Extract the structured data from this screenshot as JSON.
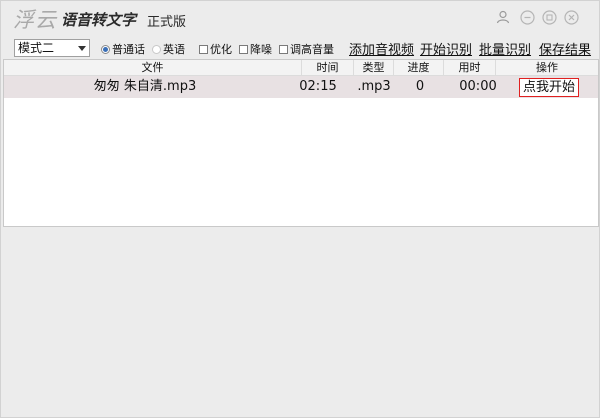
{
  "titlebar": {
    "brand": "浮云",
    "app_name": "语音转文字",
    "edition": "正式版",
    "controls": [
      "user-icon",
      "minimize-icon",
      "maximize-icon",
      "close-icon"
    ]
  },
  "toolbar": {
    "mode_select": {
      "value": "模式二"
    },
    "language_options": [
      {
        "label": "普通话",
        "selected": true
      },
      {
        "label": "英语",
        "selected": false
      }
    ],
    "checkboxes": [
      {
        "label": "优化",
        "checked": false
      },
      {
        "label": "降噪",
        "checked": false
      },
      {
        "label": "调高音量",
        "checked": false
      }
    ],
    "actions": {
      "add_media": "添加音视频",
      "start_recognition": "开始识别",
      "batch_recognition": "批量识别",
      "save_result": "保存结果"
    }
  },
  "table": {
    "columns": [
      "文件",
      "时间",
      "类型",
      "进度",
      "用时",
      "操作"
    ],
    "rows": [
      {
        "file": "匆匆 朱自清.mp3",
        "time": "02:15",
        "type": ".mp3",
        "progress": "0",
        "elapsed": "00:00",
        "action": "点我开始"
      }
    ]
  },
  "colors": {
    "action_border": "#e02020",
    "row_highlight": "#e8e1e3",
    "radio_selected": "#3a6fb7"
  }
}
